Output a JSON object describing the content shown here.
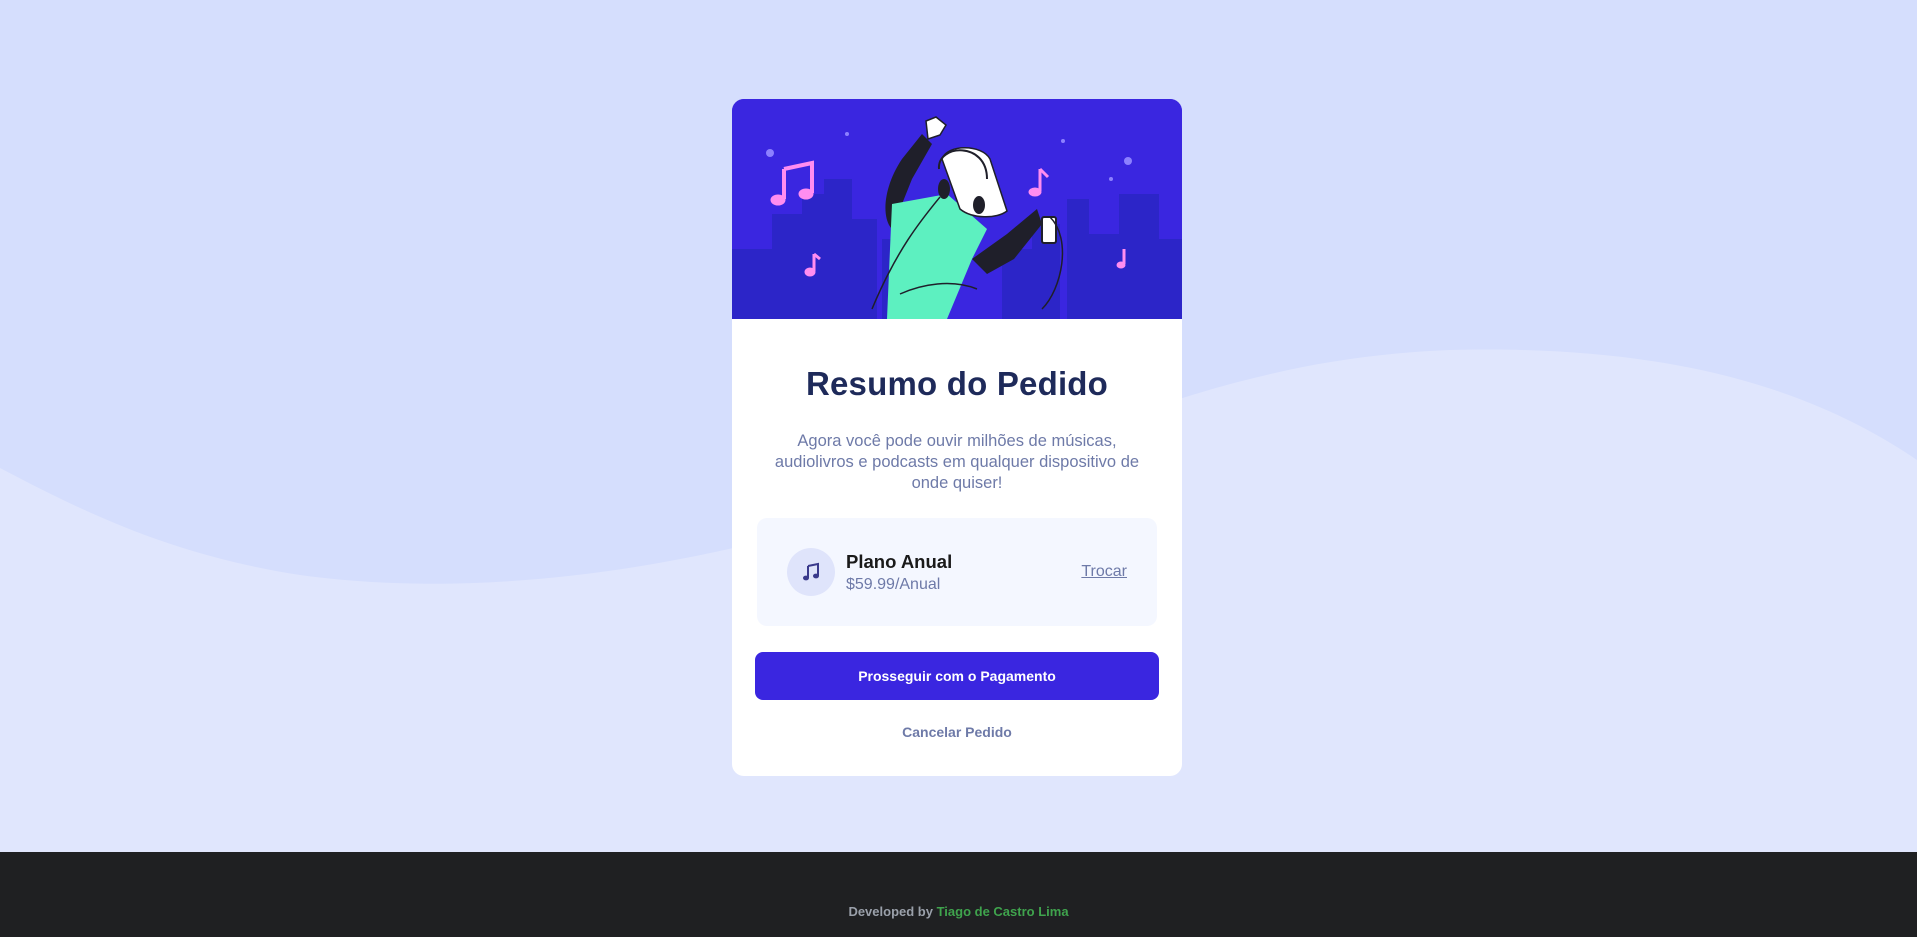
{
  "colors": {
    "accent": "#3a26e0",
    "page_background": "#e0e6fd",
    "wave": "#d5defd",
    "footer_background": "#1f2022",
    "author_link": "#3fa34d"
  },
  "hero": {
    "icon": "person-with-headphones-illustration"
  },
  "summary": {
    "title": "Resumo do Pedido",
    "description": "Agora você pode ouvir milhões de músicas, audiolivros e podcasts em qualquer dispositivo de onde quiser!"
  },
  "plan": {
    "icon": "music-note-icon",
    "name": "Plano Anual",
    "price": "$59.99/Anual",
    "change_label": "Trocar"
  },
  "actions": {
    "pay_label": "Prosseguir com o Pagamento",
    "cancel_label": "Cancelar Pedido"
  },
  "footer": {
    "prefix": "Developed by",
    "author": "Tiago de Castro Lima"
  }
}
